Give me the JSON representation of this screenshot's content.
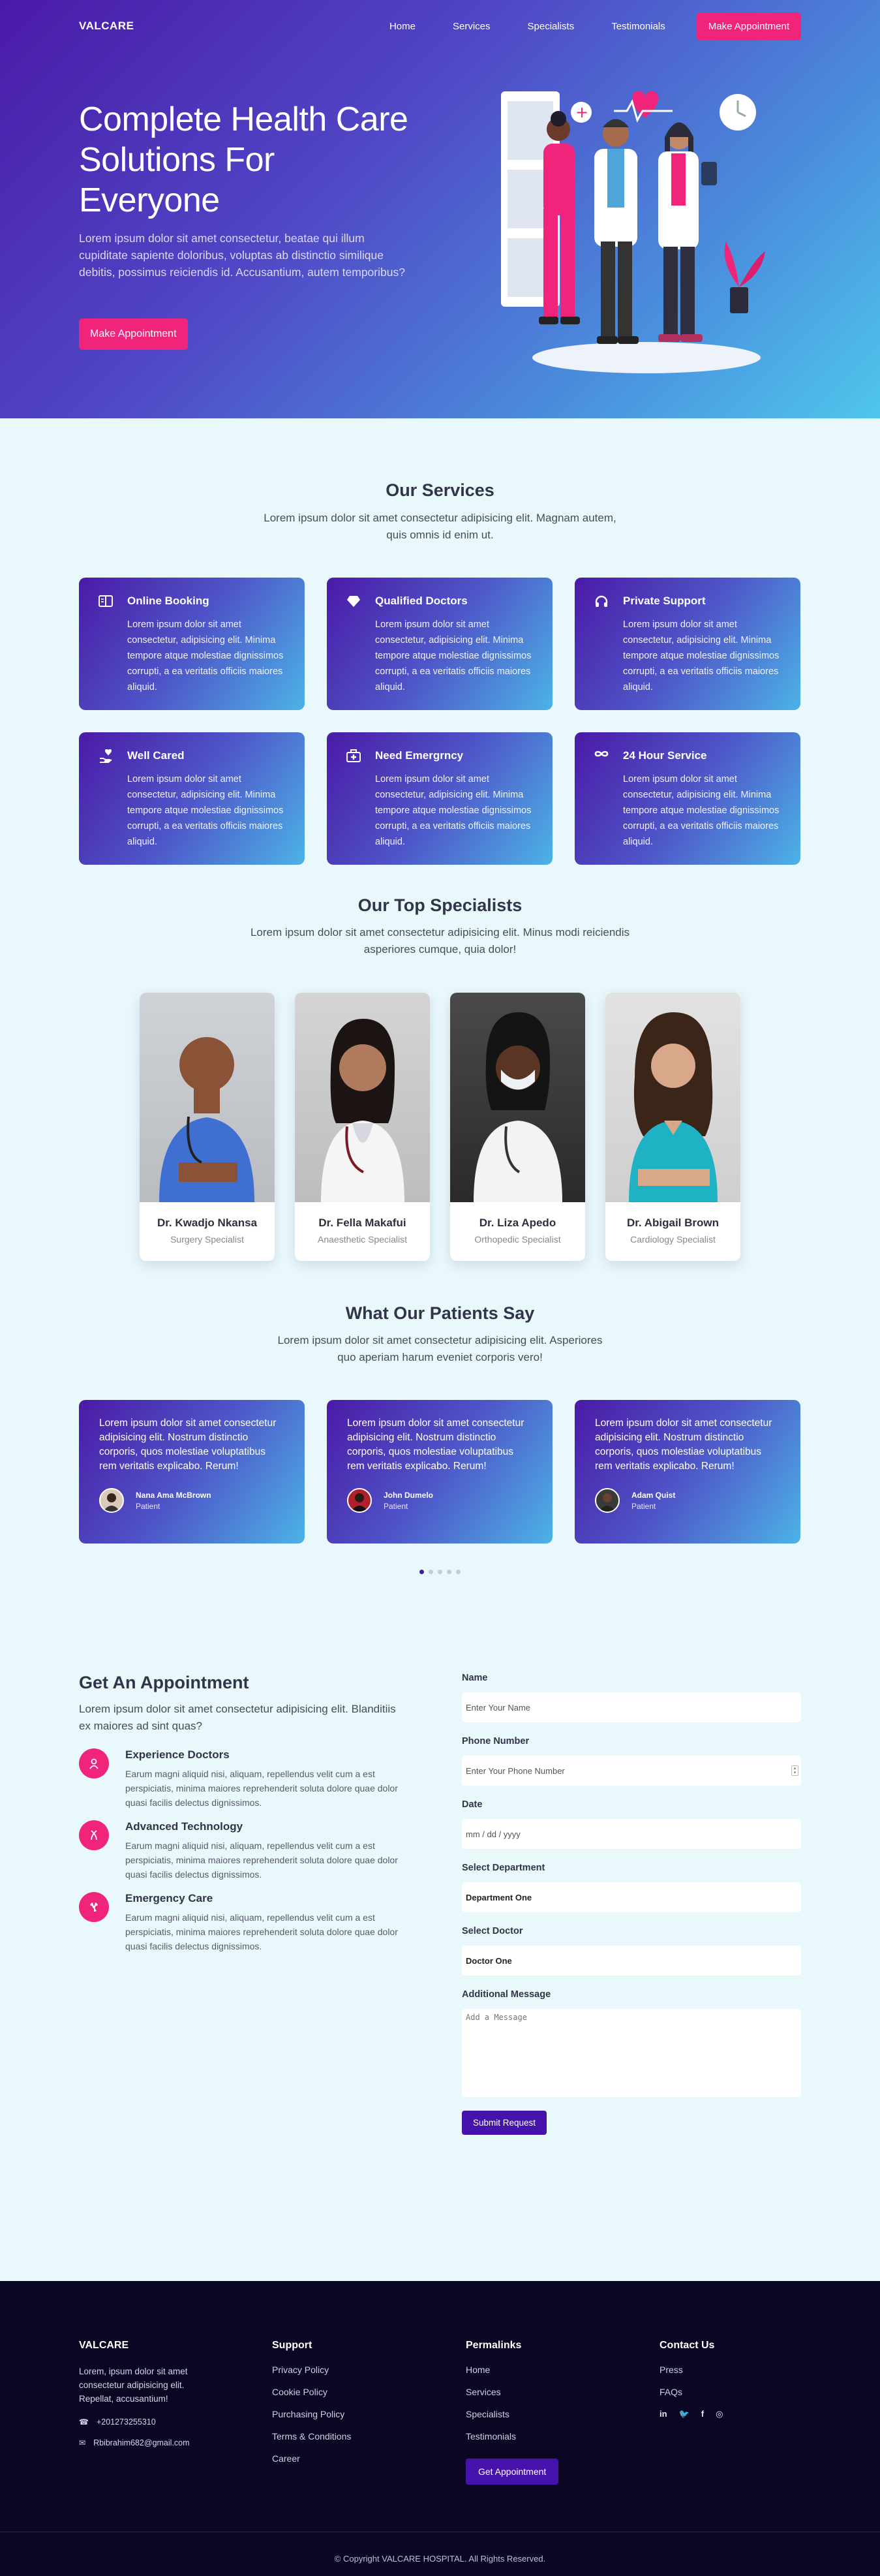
{
  "nav": {
    "logo": "VALCARE",
    "links": [
      "Home",
      "Services",
      "Specialists",
      "Testimonials"
    ],
    "cta": "Make Appointment"
  },
  "hero": {
    "title": "Complete Health Care Solutions For Everyone",
    "text": "Lorem ipsum dolor sit amet consectetur, beatae qui illum cupiditate sapiente doloribus, voluptas ab distinctio similique debitis, possimus reiciendis id. Accusantium, autem temporibus?",
    "cta": "Make Appointment"
  },
  "services": {
    "title": "Our Services",
    "subtitle": "Lorem ipsum dolor sit amet consectetur adipisicing elit. Magnam autem, quis omnis id enim ut.",
    "items": [
      {
        "icon": "book-icon",
        "title": "Online Booking",
        "text": "Lorem ipsum dolor sit amet consectetur, adipisicing elit. Minima tempore atque molestiae dignissimos corrupti, a ea veritatis officiis maiores aliquid."
      },
      {
        "icon": "diamond-icon",
        "title": "Qualified Doctors",
        "text": "Lorem ipsum dolor sit amet consectetur, adipisicing elit. Minima tempore atque molestiae dignissimos corrupti, a ea veritatis officiis maiores aliquid."
      },
      {
        "icon": "headset-icon",
        "title": "Private Support",
        "text": "Lorem ipsum dolor sit amet consectetur, adipisicing elit. Minima tempore atque molestiae dignissimos corrupti, a ea veritatis officiis maiores aliquid."
      },
      {
        "icon": "hand-heart-icon",
        "title": "Well Cared",
        "text": "Lorem ipsum dolor sit amet consectetur, adipisicing elit. Minima tempore atque molestiae dignissimos corrupti, a ea veritatis officiis maiores aliquid."
      },
      {
        "icon": "first-aid-icon",
        "title": "Need Emergrncy",
        "text": "Lorem ipsum dolor sit amet consectetur, adipisicing elit. Minima tempore atque molestiae dignissimos corrupti, a ea veritatis officiis maiores aliquid."
      },
      {
        "icon": "infinity-icon",
        "title": "24 Hour Service",
        "text": "Lorem ipsum dolor sit amet consectetur, adipisicing elit. Minima tempore atque molestiae dignissimos corrupti, a ea veritatis officiis maiores aliquid."
      }
    ]
  },
  "specialists": {
    "title": "Our Top Specialists",
    "subtitle": "Lorem ipsum dolor sit amet consectetur adipisicing elit. Minus modi reiciendis asperiores cumque, quia dolor!",
    "doctors": [
      {
        "name": "Dr. Kwadjo Nkansa",
        "role": "Surgery Specialist"
      },
      {
        "name": "Dr. Fella Makafui",
        "role": "Anaesthetic Specialist"
      },
      {
        "name": "Dr. Liza Apedo",
        "role": "Orthopedic Specialist"
      },
      {
        "name": "Dr. Abigail Brown",
        "role": "Cardiology Specialist"
      }
    ]
  },
  "testimonials": {
    "title": "What Our Patients Say",
    "subtitle": "Lorem ipsum dolor sit amet consectetur adipisicing elit. Asperiores quo aperiam harum eveniet corporis vero!",
    "items": [
      {
        "text": "Lorem ipsum dolor sit amet consectetur adipisicing elit. Nostrum distinctio corporis, quos molestiae voluptatibus rem veritatis explicabo. Rerum!",
        "name": "Nana Ama McBrown",
        "role": "Patient"
      },
      {
        "text": "Lorem ipsum dolor sit amet consectetur adipisicing elit. Nostrum distinctio corporis, quos molestiae voluptatibus rem veritatis explicabo. Rerum!",
        "name": "John Dumelo",
        "role": "Patient"
      },
      {
        "text": "Lorem ipsum dolor sit amet consectetur adipisicing elit. Nostrum distinctio corporis, quos molestiae voluptatibus rem veritatis explicabo. Rerum!",
        "name": "Adam Quist",
        "role": "Patient"
      }
    ],
    "dots_count": 5,
    "active_dot": 1
  },
  "appointment": {
    "title": "Get An Appointment",
    "lead": "Lorem ipsum dolor sit amet consectetur adipisicing elit. Blanditiis ex maiores ad sint quas?",
    "features": [
      {
        "icon": "doctor-icon",
        "title": "Experience Doctors",
        "text": "Earum magni aliquid nisi, aliquam, repellendus velit cum a est perspiciatis, minima maiores reprehenderit soluta dolore quae dolor quasi facilis delectus dignissimos."
      },
      {
        "icon": "dna-icon",
        "title": "Advanced Technology",
        "text": "Earum magni aliquid nisi, aliquam, repellendus velit cum a est perspiciatis, minima maiores reprehenderit soluta dolore quae dolor quasi facilis delectus dignissimos."
      },
      {
        "icon": "radiation-icon",
        "title": "Emergency Care",
        "text": "Earum magni aliquid nisi, aliquam, repellendus velit cum a est perspiciatis, minima maiores reprehenderit soluta dolore quae dolor quasi facilis delectus dignissimos."
      }
    ],
    "form": {
      "name_label": "Name",
      "name_placeholder": "Enter Your Name",
      "phone_label": "Phone Number",
      "phone_placeholder": "Enter Your Phone Number",
      "date_label": "Date",
      "date_placeholder": "mm / dd / yyyy",
      "dept_label": "Select Department",
      "dept_value": "Department One",
      "doctor_label": "Select Doctor",
      "doctor_value": "Doctor One",
      "message_label": "Additional Message",
      "message_placeholder": "Add a Message",
      "submit": "Submit Request"
    }
  },
  "footer": {
    "brand": "VALCARE",
    "about": "Lorem, ipsum dolor sit amet consectetur adipisicing elit. Repellat, accusantium!",
    "phone": "+201273255310",
    "email": "Rbibrahim682@gmail.com",
    "support_title": "Support",
    "support_links": [
      "Privacy Policy",
      "Cookie Policy",
      "Purchasing Policy",
      "Terms & Conditions",
      "Career"
    ],
    "permalinks_title": "Permalinks",
    "permalinks": [
      "Home",
      "Services",
      "Specialists",
      "Testimonials"
    ],
    "permalinks_cta": "Get Appointment",
    "contact_title": "Contact Us",
    "contact_links": [
      "Press",
      "FAQs"
    ],
    "social": [
      "in",
      "tw",
      "f",
      "ig"
    ],
    "copyright": "© Copyright VALCARE HOSPITAL. All Rights Reserved."
  },
  "colors": {
    "accent_pink": "#f0247a",
    "accent_purple": "#4513ab",
    "footer_bg": "#0b0623"
  }
}
